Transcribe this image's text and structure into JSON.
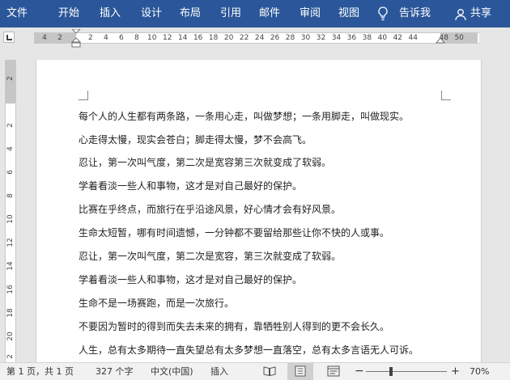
{
  "ribbon": {
    "tabs": [
      "文件",
      "开始",
      "插入",
      "设计",
      "布局",
      "引用",
      "邮件",
      "审阅",
      "视图"
    ],
    "tell_me": "告诉我",
    "share": "共享"
  },
  "ruler": {
    "horizontal_ticks": [
      "4",
      "2",
      "",
      "2",
      "4",
      "6",
      "8",
      "10",
      "12",
      "14",
      "16",
      "18",
      "20",
      "22",
      "24",
      "26",
      "28",
      "30",
      "32",
      "34",
      "36",
      "38",
      "40",
      "42",
      "44",
      "",
      "48",
      "50"
    ],
    "vertical_ticks": [
      "2",
      "2",
      "4",
      "6",
      "8",
      "10",
      "12",
      "14",
      "16",
      "18",
      "20",
      "2"
    ]
  },
  "document": {
    "lines": [
      "每个人的人生都有两条路，一条用心走，叫做梦想；一条用脚走，叫做现实。",
      "心走得太慢，现实会苍白；脚走得太慢，梦不会高飞。",
      "忍让，第一次叫气度，第二次是宽容第三次就变成了软弱。",
      "学着看淡一些人和事物，这才是对自己最好的保护。",
      "比赛在乎终点，而旅行在乎沿途风景，好心情才会有好风景。",
      "生命太短暂，哪有时间遗憾，一分钟都不要留给那些让你不快的人或事。",
      "忍让，第一次叫气度，第二次是宽容，第三次就变成了软弱。",
      "学着看淡一些人和事物，这才是对自己最好的保护。",
      "生命不是一场赛跑，而是一次旅行。",
      "不要因为暂时的得到而失去未来的拥有，靠牺牲别人得到的更不会长久。",
      "人生，总有太多期待一直失望总有太多梦想一直落空，总有太多言语无人可诉。"
    ]
  },
  "status": {
    "page": "第 1 页，共 1 页",
    "words": "327 个字",
    "language": "中文(中国)",
    "mode": "插入",
    "zoom_minus": "−",
    "zoom_plus": "+",
    "zoom": "70%"
  },
  "colors": {
    "ribbon": "#2b579a",
    "status_bar": "#f1f1f1"
  }
}
